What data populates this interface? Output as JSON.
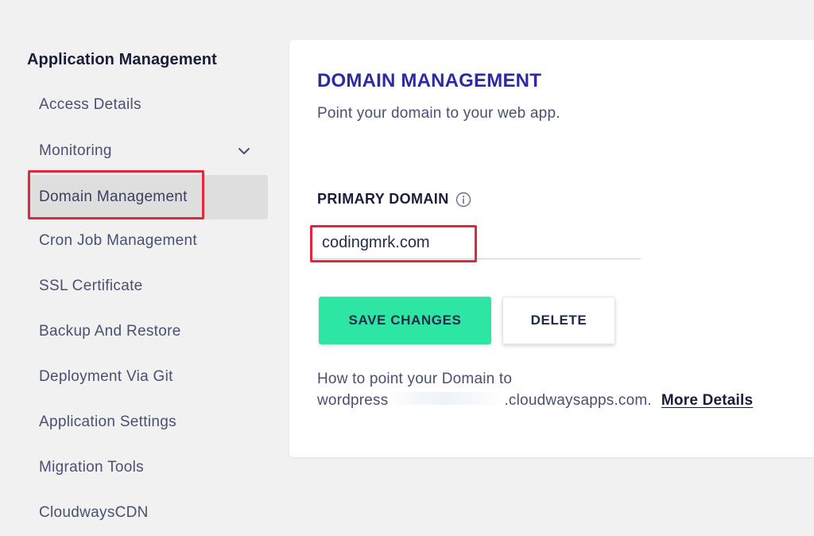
{
  "sidebar": {
    "heading": "Application Management",
    "items": [
      {
        "label": "Access Details"
      },
      {
        "label": "Monitoring"
      },
      {
        "label": "Domain Management"
      },
      {
        "label": "Cron Job Management"
      },
      {
        "label": "SSL Certificate"
      },
      {
        "label": "Backup And Restore"
      },
      {
        "label": "Deployment Via Git"
      },
      {
        "label": "Application Settings"
      },
      {
        "label": "Migration Tools"
      },
      {
        "label": "CloudwaysCDN"
      }
    ],
    "active_item": "Domain Management"
  },
  "main": {
    "title": "DOMAIN MANAGEMENT",
    "subtitle": "Point your domain to your web app.",
    "primary_domain": {
      "label": "PRIMARY DOMAIN",
      "value": "codingmrk.com"
    },
    "buttons": {
      "save": "SAVE CHANGES",
      "delete": "DELETE"
    },
    "help": {
      "line1": "How to point your Domain to",
      "line2_prefix": "wordpress",
      "line2_suffix": ".cloudwaysapps.com.",
      "link": "More Details"
    }
  },
  "icons": {
    "chevron": "chevron-down-icon",
    "info": "info-icon"
  },
  "colors": {
    "title": "#2d2aa2",
    "save_button": "#2ee6a3",
    "highlight": "#e0283d",
    "active_nav_bg": "#dedede",
    "page_bg": "#f1f1f1"
  }
}
